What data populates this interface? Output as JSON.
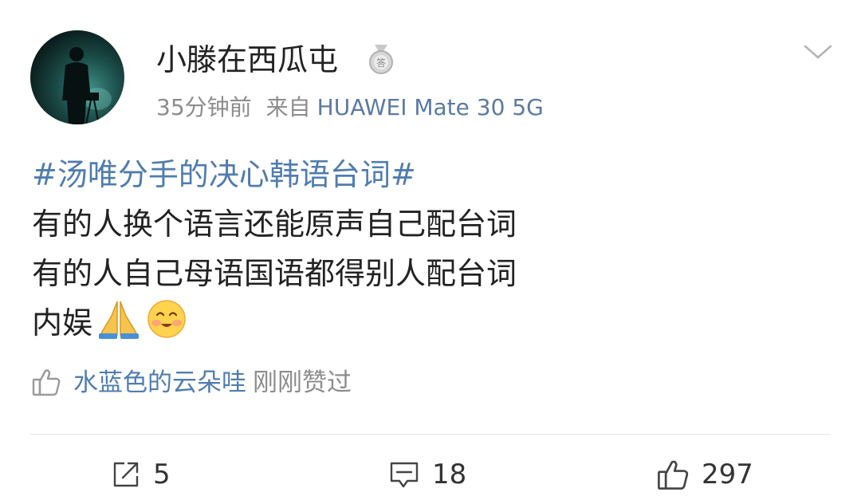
{
  "post": {
    "username": "小滕在西瓜屯",
    "time": "35分钟前",
    "source_prefix": "来自",
    "device": "HUAWEI Mate 30 5G",
    "topic": "#汤唯分手的决心韩语台词#",
    "lines": [
      "有的人换个语言还能原声自己配台词",
      "有的人自己母语国语都得别人配台词",
      "内娱"
    ],
    "emojis": [
      "pray-emoji",
      "blush-smile-emoji"
    ]
  },
  "likes": {
    "liker": "水蓝色的云朵哇",
    "status": "刚刚赞过"
  },
  "actions": {
    "repost_count": "5",
    "comment_count": "18",
    "like_count": "297"
  },
  "colors": {
    "link_blue": "#507daf",
    "device_blue": "#5b7aa3",
    "meta_gray": "#8c8c8c",
    "text": "#222222",
    "divider": "#e6e6e6"
  }
}
